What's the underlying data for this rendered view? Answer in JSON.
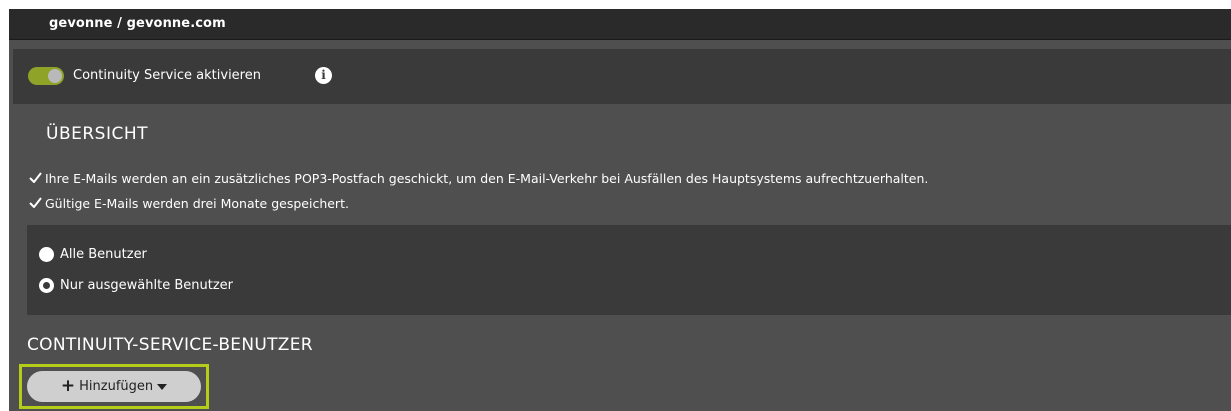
{
  "header": {
    "title": "gevonne / gevonne.com"
  },
  "continuity": {
    "toggle_label": "Continuity Service aktivieren",
    "toggle_on": true,
    "info_icon": "info-icon",
    "accent_color": "#8fa328"
  },
  "overview": {
    "title": "ÜBERSICHT",
    "items": [
      "Ihre E-Mails werden an ein zusätzliches POP3-Postfach geschickt, um den E-Mail-Verkehr bei Ausfällen des Hauptsystems aufrechtzuerhalten.",
      "Gültige E-Mails werden drei Monate gespeichert."
    ]
  },
  "user_scope": {
    "options": [
      {
        "label": "Alle Benutzer",
        "selected": false
      },
      {
        "label": "Nur ausgewählte Benutzer",
        "selected": true
      }
    ]
  },
  "users_section": {
    "title": "CONTINUITY-SERVICE-BENUTZER",
    "add_button_label": "Hinzufügen",
    "highlight_color": "#b5cc18"
  }
}
